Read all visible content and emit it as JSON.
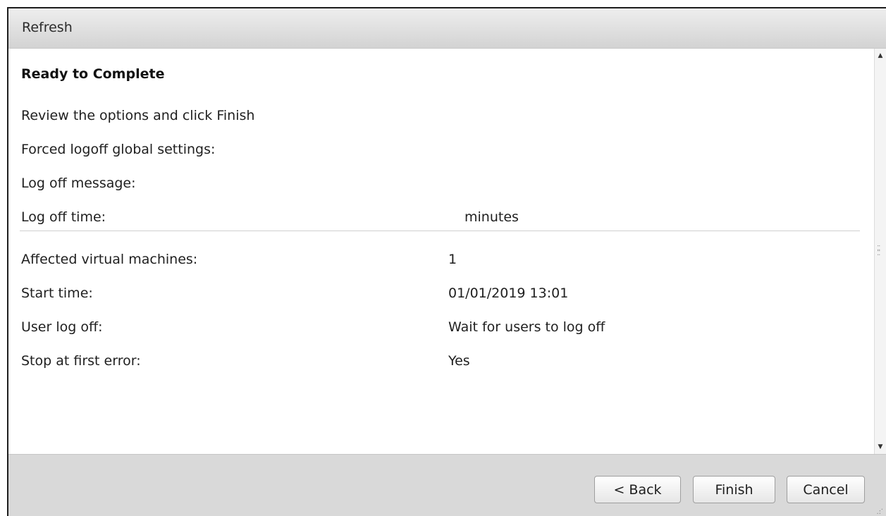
{
  "window": {
    "title": "Refresh"
  },
  "content": {
    "heading": "Ready to Complete",
    "instruction": "Review the options and click Finish",
    "forced_logoff_label": "Forced logoff global settings:",
    "logoff_message_label": "Log off message:",
    "logoff_time_label": "Log off time:",
    "logoff_time_value": "minutes",
    "summary": [
      {
        "label": "Affected virtual machines:",
        "value": "1"
      },
      {
        "label": "Start time:",
        "value": "01/01/2019 13:01"
      },
      {
        "label": "User log off:",
        "value": "Wait for users to log off"
      },
      {
        "label": "Stop at first error:",
        "value": "Yes"
      }
    ]
  },
  "footer": {
    "back_label": "< Back",
    "finish_label": "Finish",
    "cancel_label": "Cancel"
  },
  "scrollbar": {
    "up_glyph": "▲",
    "down_glyph": "▼"
  }
}
